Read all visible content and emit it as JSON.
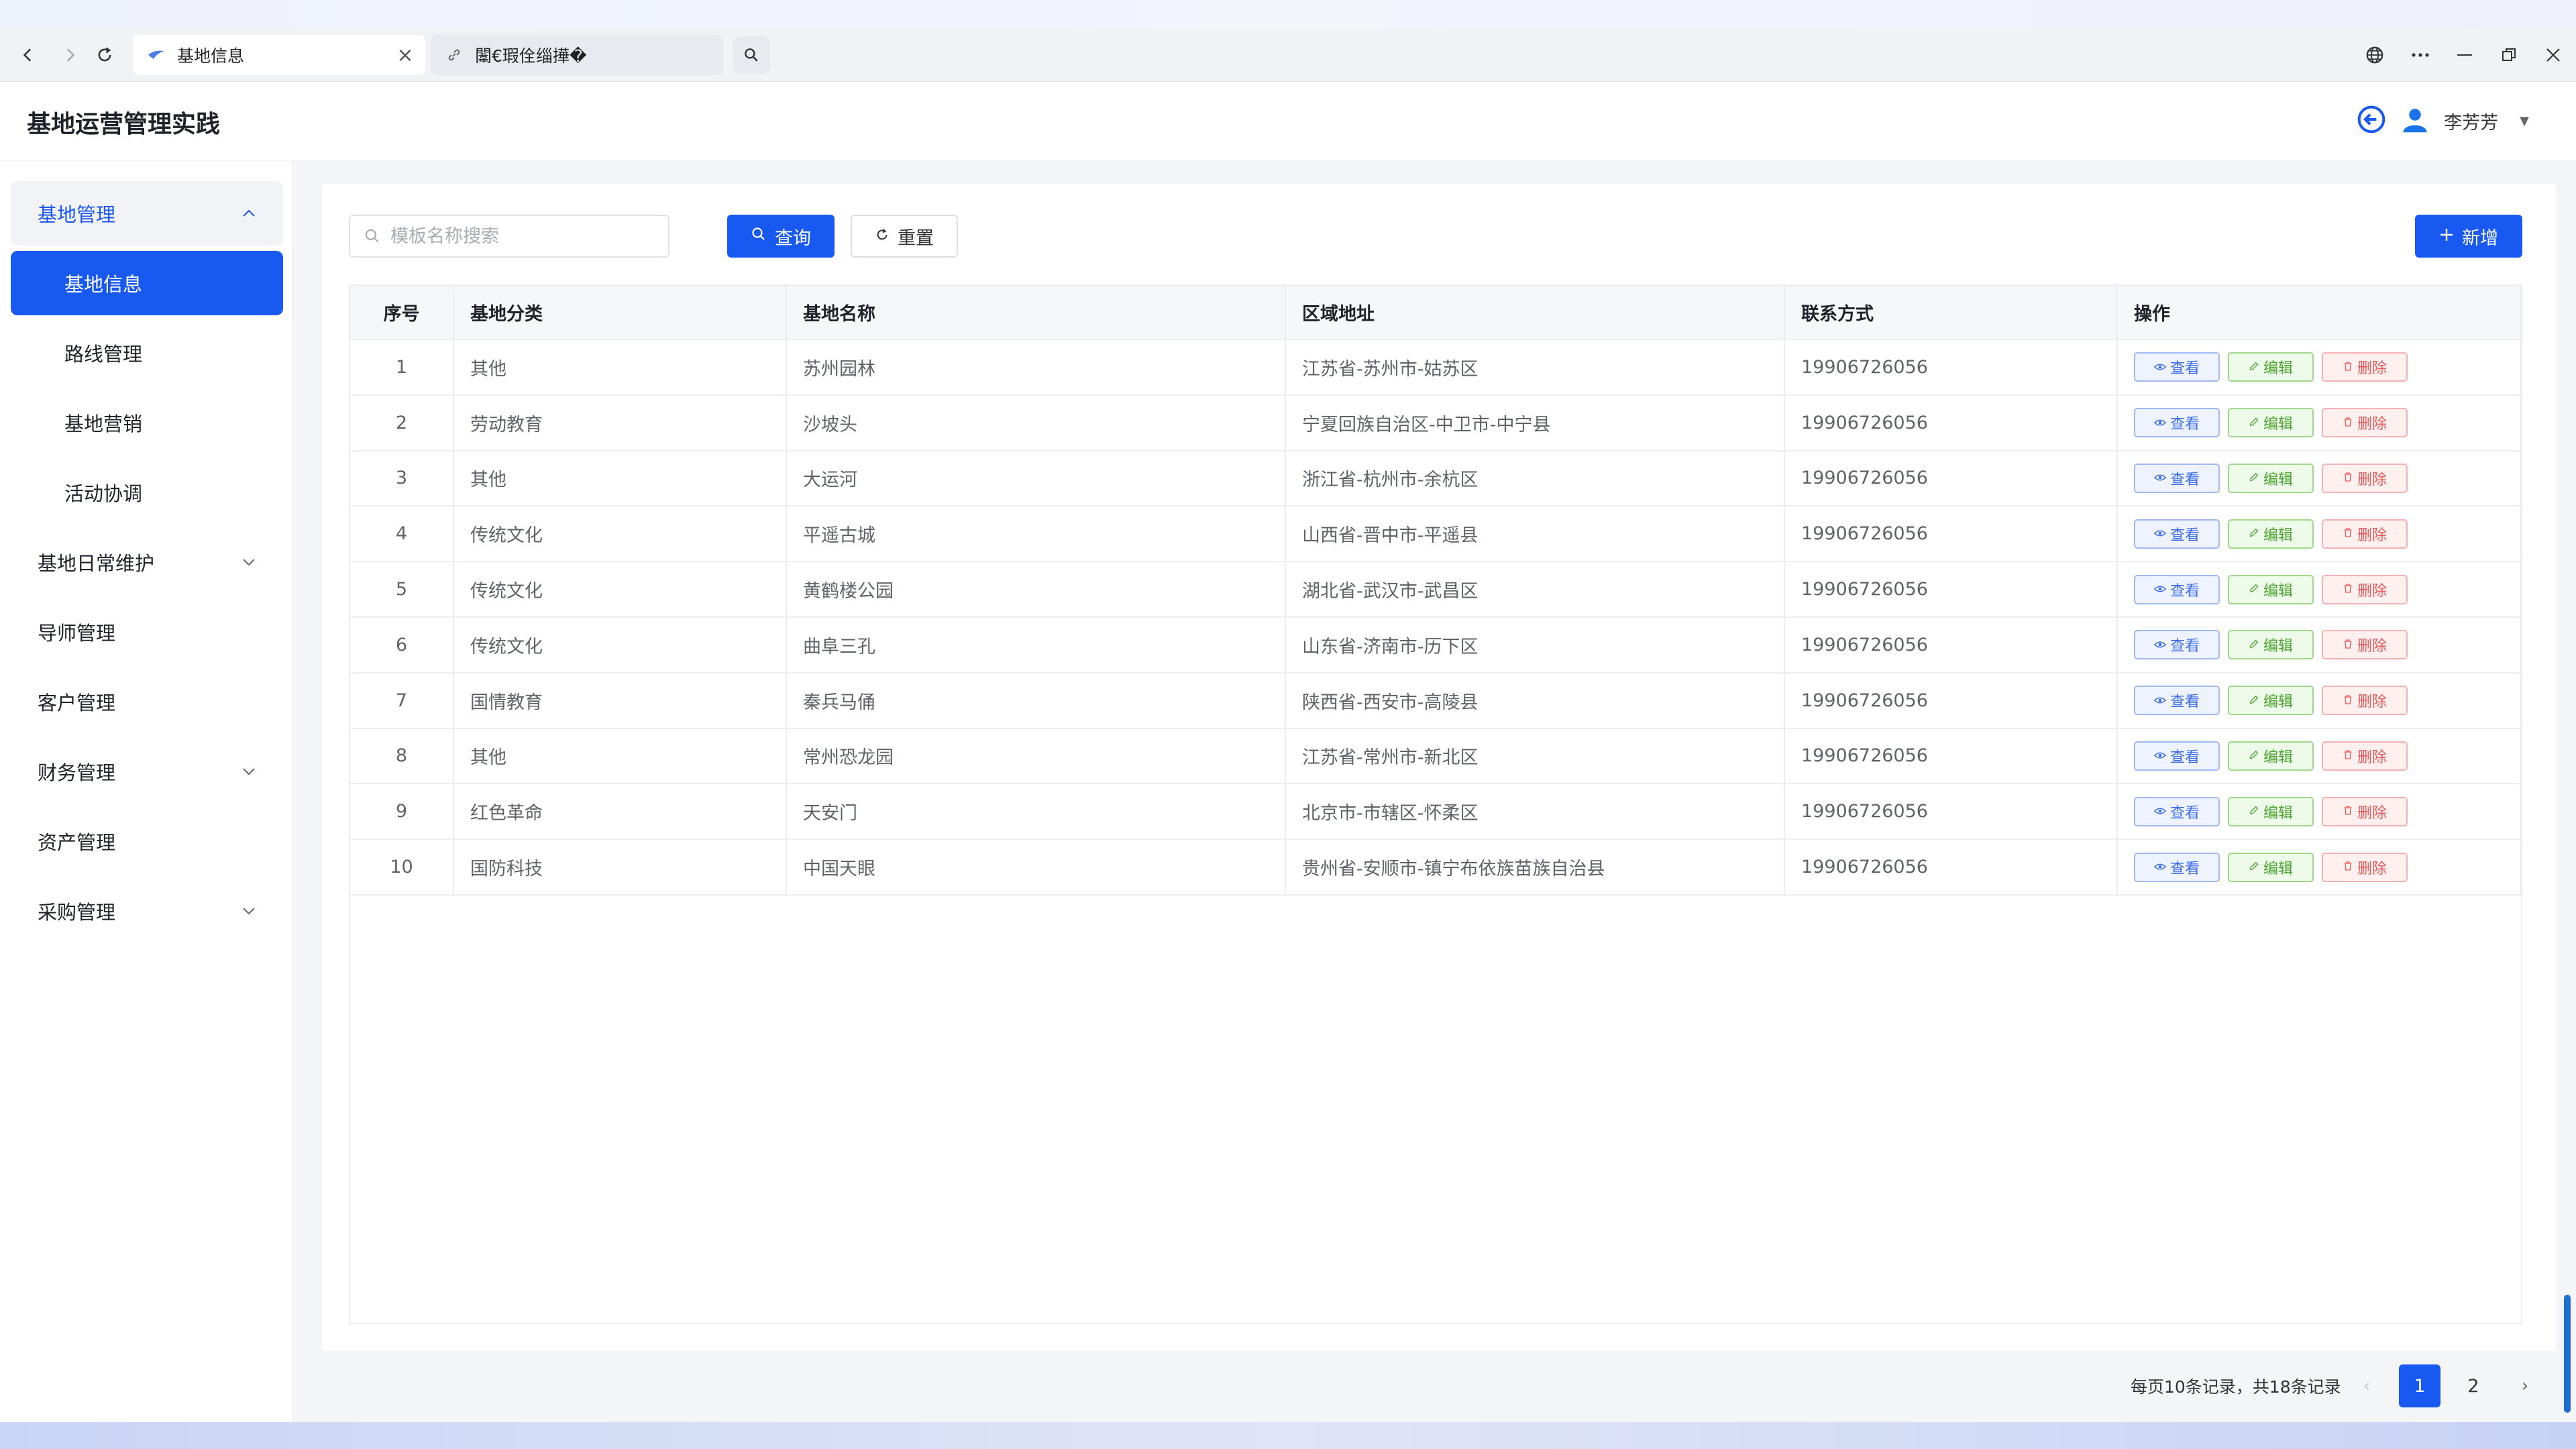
{
  "browser": {
    "tabs": [
      {
        "label": "基地信息",
        "active": true
      },
      {
        "label": "闈€瑕佺缁撶�",
        "active": false
      }
    ],
    "close_glyph": "×"
  },
  "app": {
    "title": "基地运营管理实践",
    "user_name": "李芳芳"
  },
  "sidebar": {
    "groups": [
      {
        "label": "基地管理",
        "expanded": true,
        "children": [
          {
            "label": "基地信息",
            "active": true
          },
          {
            "label": "路线管理"
          },
          {
            "label": "基地营销"
          },
          {
            "label": "活动协调"
          }
        ]
      },
      {
        "label": "基地日常维护",
        "expandable": true
      },
      {
        "label": "导师管理"
      },
      {
        "label": "客户管理"
      },
      {
        "label": "财务管理",
        "expandable": true
      },
      {
        "label": "资产管理"
      },
      {
        "label": "采购管理",
        "expandable": true
      }
    ]
  },
  "toolbar": {
    "search_placeholder": "模板名称搜索",
    "query_label": "查询",
    "reset_label": "重置",
    "add_label": "新增"
  },
  "table": {
    "columns": [
      "序号",
      "基地分类",
      "基地名称",
      "区域地址",
      "联系方式",
      "操作"
    ],
    "action_labels": {
      "view": "查看",
      "edit": "编辑",
      "delete": "删除"
    },
    "rows": [
      {
        "no": "1",
        "category": "其他",
        "name": "苏州园林",
        "address": "江苏省-苏州市-姑苏区",
        "contact": "19906726056"
      },
      {
        "no": "2",
        "category": "劳动教育",
        "name": "沙坡头",
        "address": "宁夏回族自治区-中卫市-中宁县",
        "contact": "19906726056"
      },
      {
        "no": "3",
        "category": "其他",
        "name": "大运河",
        "address": "浙江省-杭州市-余杭区",
        "contact": "19906726056"
      },
      {
        "no": "4",
        "category": "传统文化",
        "name": "平遥古城",
        "address": "山西省-晋中市-平遥县",
        "contact": "19906726056"
      },
      {
        "no": "5",
        "category": "传统文化",
        "name": "黄鹤楼公园",
        "address": "湖北省-武汉市-武昌区",
        "contact": "19906726056"
      },
      {
        "no": "6",
        "category": "传统文化",
        "name": "曲阜三孔",
        "address": "山东省-济南市-历下区",
        "contact": "19906726056"
      },
      {
        "no": "7",
        "category": "国情教育",
        "name": "秦兵马俑",
        "address": "陕西省-西安市-高陵县",
        "contact": "19906726056"
      },
      {
        "no": "8",
        "category": "其他",
        "name": "常州恐龙园",
        "address": "江苏省-常州市-新北区",
        "contact": "19906726056"
      },
      {
        "no": "9",
        "category": "红色革命",
        "name": "天安门",
        "address": "北京市-市辖区-怀柔区",
        "contact": "19906726056"
      },
      {
        "no": "10",
        "category": "国防科技",
        "name": "中国天眼",
        "address": "贵州省-安顺市-镇宁布依族苗族自治县",
        "contact": "19906726056"
      }
    ]
  },
  "pagination": {
    "info": "每页10条记录，共18条记录",
    "pages": [
      "1",
      "2"
    ],
    "current": "1"
  },
  "colors": {
    "primary": "#1859f2",
    "view": "#3b6ce8",
    "edit": "#4aa32e",
    "delete": "#e85a5a"
  }
}
